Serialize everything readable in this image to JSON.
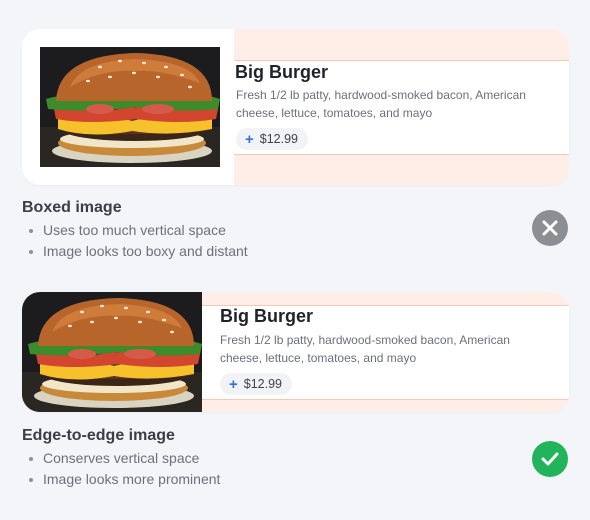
{
  "examples": [
    {
      "card": {
        "title": "Big Burger",
        "description": "Fresh 1/2 lb patty, hardwood-smoked bacon, American cheese, lettuce, tomatoes, and mayo",
        "price_icon": "plus",
        "price": "$12.99"
      },
      "heading": "Boxed image",
      "points": [
        "Uses too much vertical space",
        "Image looks too boxy and distant"
      ],
      "verdict_icon": "x-circle-icon",
      "verdict_color": "#8b8e93"
    },
    {
      "card": {
        "title": "Big Burger",
        "description": "Fresh 1/2 lb patty, hardwood-smoked bacon, American cheese, lettuce, tomatoes, and mayo",
        "price_icon": "plus",
        "price": "$12.99"
      },
      "heading": "Edge-to-edge image",
      "points": [
        "Conserves vertical space",
        "Image looks more prominent"
      ],
      "verdict_icon": "check-circle-icon",
      "verdict_color": "#22b45a"
    }
  ],
  "colors": {
    "background": "#f3f5f8",
    "card": "#ffffff",
    "spacing_overlay": "#ffeee8",
    "price_plus": "#3b6fd8"
  }
}
